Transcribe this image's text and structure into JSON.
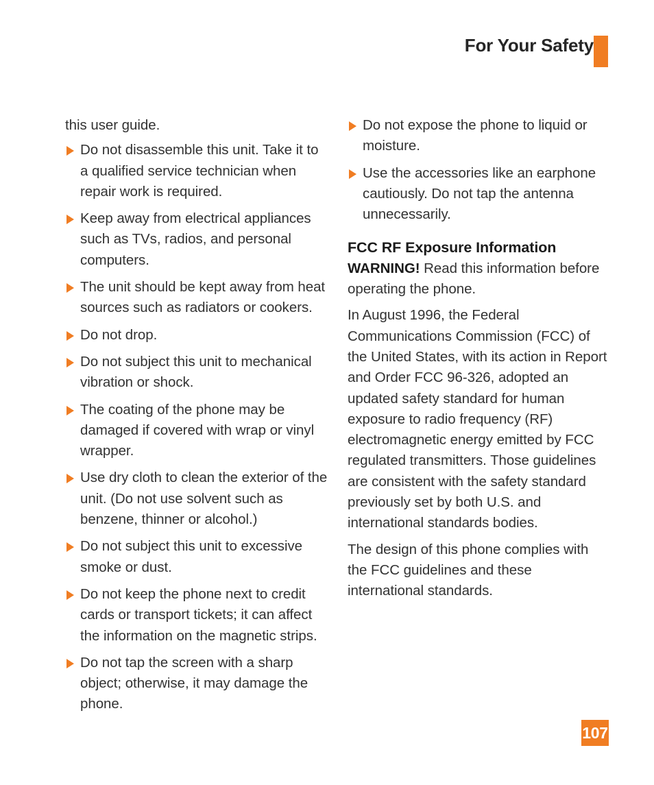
{
  "header": {
    "title": "For Your Safety",
    "accent_color": "#f07d23"
  },
  "page_number": "107",
  "left_column": {
    "lead_paragraph": "this user guide.",
    "bullets": [
      "Do not disassemble this unit. Take it to a qualified service technician when repair work is required.",
      "Keep away from electrical appliances such as TVs, radios, and personal computers.",
      "The unit should be kept away from heat sources such as radiators or cookers.",
      "Do not drop.",
      "Do not subject this unit to mechanical vibration or shock.",
      "The coating of the phone may be damaged if covered with wrap or vinyl wrapper.",
      "Use dry cloth to clean the exterior of the unit. (Do not use solvent such as benzene, thinner or alcohol.)",
      "Do not subject this unit to excessive smoke or dust.",
      "Do not keep the phone next to credit cards or transport tickets; it can affect the information on the magnetic strips.",
      "Do not tap the screen with a sharp object; otherwise, it may damage the phone."
    ]
  },
  "right_column": {
    "bullets": [
      "Do not expose the phone to liquid or moisture.",
      "Use the accessories like an earphone cautiously. Do not tap the antenna unnecessarily."
    ],
    "section_heading": "FCC RF Exposure Information",
    "warning_label": "WARNING!",
    "warning_text": " Read this information before operating the phone.",
    "paragraphs": [
      "In August 1996, the Federal Communications Commission (FCC) of the United States, with its action in Report and Order FCC 96-326, adopted an updated safety standard for human exposure to radio frequency (RF) electromagnetic energy emitted by FCC regulated transmitters. Those guidelines are consistent with the safety standard previously set by both U.S. and international standards bodies.",
      "The design of this phone complies with the FCC guidelines and these international standards."
    ]
  }
}
